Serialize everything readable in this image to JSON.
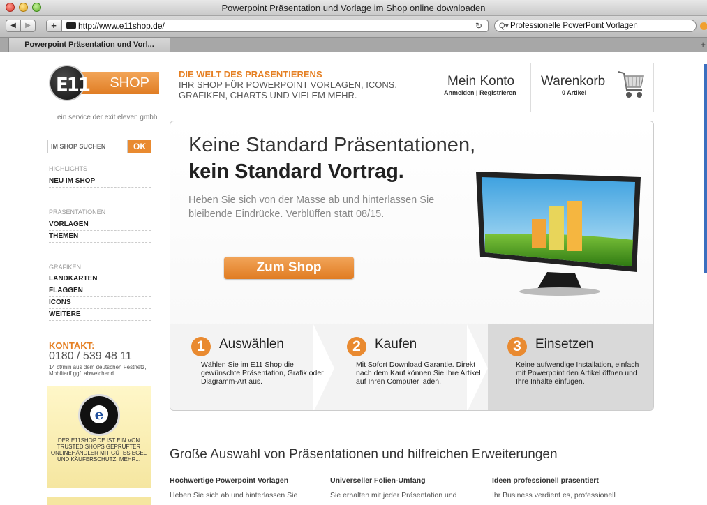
{
  "browser": {
    "window_title": "Powerpoint Präsentation und Vorlage im Shop online downloaden",
    "url": "http://www.e11shop.de/",
    "reload_glyph": "↻",
    "search_value": "Professionelle PowerPoint Vorlagen",
    "tab_label": "Powerpoint Präsentation und Vorl...",
    "nav_back_glyph": "◀",
    "nav_fwd_glyph": "▶",
    "add_glyph": "+",
    "tab_add_glyph": "+"
  },
  "header": {
    "logo_text": "SHOP",
    "logo_mark": "E11",
    "tagline": "ein service der exit eleven gmbh",
    "slogan_title": "DIE WELT DES PRÄSENTIERENS",
    "slogan_text": "IHR SHOP FÜR POWERPOINT VORLAGEN, ICONS, GRAFIKEN, CHARTS UND VIELEM MEHR.",
    "account_title": "Mein Konto",
    "account_login": "Anmelden",
    "account_sep": "|",
    "account_register": "Registrieren",
    "cart_title": "Warenkorb",
    "cart_count": "0 Artikel"
  },
  "sidebar": {
    "search_placeholder": "IM SHOP SUCHEN",
    "search_button": "OK",
    "groups": [
      {
        "heading": "HIGHLIGHTS",
        "items": [
          "NEU IM SHOP"
        ]
      },
      {
        "heading": "PRÄSENTATIONEN",
        "items": [
          "VORLAGEN",
          "THEMEN"
        ]
      },
      {
        "heading": "GRAFIKEN",
        "items": [
          "LANDKARTEN",
          "FLAGGEN",
          "ICONS",
          "WEITERE"
        ]
      }
    ],
    "contact_title": "KONTAKT:",
    "contact_phone": "0180 / 539 48 11",
    "contact_note": "14 ct/min aus dem deutschen Festnetz, Mobiltarif ggf. abweichend.",
    "trusted_seal_letter": "e",
    "trusted_text": "DER E11SHOP.DE IST EIN VON TRUSTED SHOPS GEPRÜFTER ONLINEHÄNDLER MIT GÜTESIEGEL UND KÄUFERSCHUTZ. MEHR..."
  },
  "hero": {
    "title_line1": "Keine Standard Präsentationen,",
    "title_line2": "kein Standard Vortrag.",
    "text": "Heben Sie sich von der Masse ab und hinterlassen Sie bleibende Eindrücke. Verblüffen statt 08/15.",
    "button": "Zum Shop"
  },
  "steps": [
    {
      "num": "1",
      "title": "Auswählen",
      "text": "Wählen Sie im E11 Shop die gewünschte Präsentation, Grafik oder Diagramm-Art aus."
    },
    {
      "num": "2",
      "title": "Kaufen",
      "text": "Mit Sofort Download Garantie. Direkt nach dem Kauf können Sie Ihre Artikel auf Ihren Computer laden."
    },
    {
      "num": "3",
      "title": "Einsetzen",
      "text": "Keine aufwendige Installation, einfach mit Powerpoint den Artikel öffnen und Ihre Inhalte einfügen."
    }
  ],
  "content": {
    "section_title": "Große Auswahl von Präsentationen und hilfreichen Erweiterungen",
    "columns": [
      {
        "heading": "Hochwertige Powerpoint Vorlagen",
        "text": "Heben Sie sich ab und hinterlassen Sie"
      },
      {
        "heading": "Universeller Folien-Umfang",
        "text": "Sie erhalten mit jeder Präsentation und"
      },
      {
        "heading": "Ideen professionell präsentiert",
        "text": "Ihr Business verdient es, professionell"
      }
    ]
  },
  "colors": {
    "accent": "#e98a30",
    "text": "#333333"
  }
}
